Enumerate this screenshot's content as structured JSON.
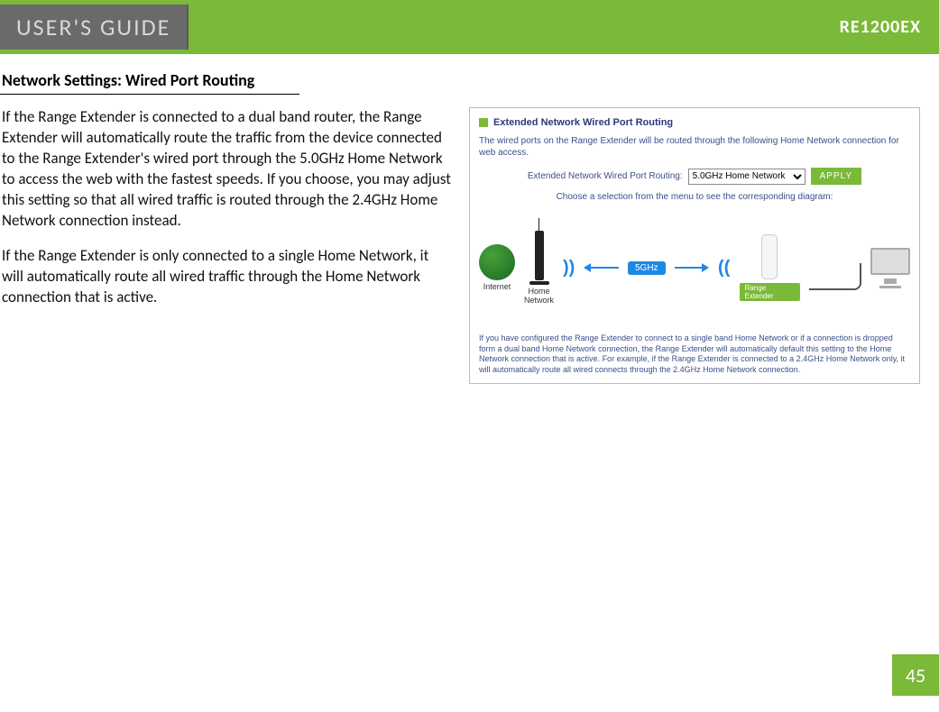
{
  "header": {
    "guide_label": "USER'S GUIDE",
    "model": "RE1200EX"
  },
  "section_title": "Network Settings: Wired Port Routing",
  "paragraphs": {
    "p1": "If the Range Extender is connected to a dual band router, the Range Extender will automatically route the traffic from the device connected to the Range Extender's wired port through the 5.0GHz Home Network to access the web with the fastest speeds. If you choose, you may adjust this setting so that all wired traffic is routed through the 2.4GHz Home Network connection instead.",
    "p2": "If the Range Extender is only connected to a single Home Network, it will automatically route all wired traffic through the Home Network connection that is active."
  },
  "panel": {
    "title": "Extended Network Wired Port Routing",
    "desc": "The wired ports on the Range Extender will be routed through the following Home Network connection for web access.",
    "control_label": "Extended Network Wired Port Routing:",
    "select_value": "5.0GHz Home Network",
    "apply": "APPLY",
    "choose_text": "Choose a selection from the menu to see the corresponding diagram:",
    "diagram": {
      "internet": "Internet",
      "home_network": "Home\nNetwork",
      "band": "5GHz",
      "range_extender": "Range Extender"
    },
    "footer": "If you have configured the Range Extender to connect to a single band Home Network or if a connection is dropped form a dual band Home Network connection, the Range Extender will automatically default this setting to the Home Network connection that is active. For example, if the Range Extender is connected to a 2.4GHz Home Network only, it will automatically route all wired connects through the 2.4GHz Home Network connection."
  },
  "page_number": "45"
}
